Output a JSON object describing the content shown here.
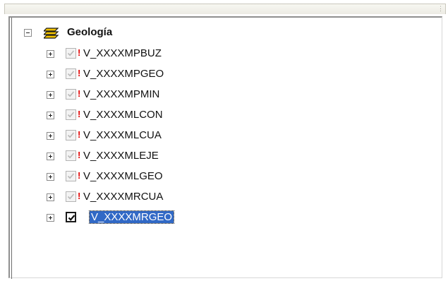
{
  "toc": {
    "group": {
      "label": "Geología",
      "expanded": true,
      "icon": "layers-icon"
    },
    "layers": [
      {
        "label": "V_XXXXMPBUZ",
        "checked": true,
        "disabled": true,
        "warning": true
      },
      {
        "label": "V_XXXXMPGEO",
        "checked": true,
        "disabled": true,
        "warning": true
      },
      {
        "label": "V_XXXXMPMIN",
        "checked": true,
        "disabled": true,
        "warning": true
      },
      {
        "label": "V_XXXXMLCON",
        "checked": true,
        "disabled": true,
        "warning": true
      },
      {
        "label": "V_XXXXMLCUA",
        "checked": true,
        "disabled": true,
        "warning": true
      },
      {
        "label": "V_XXXXMLEJE",
        "checked": true,
        "disabled": true,
        "warning": true
      },
      {
        "label": "V_XXXXMLGEO",
        "checked": true,
        "disabled": true,
        "warning": true
      },
      {
        "label": "V_XXXXMRCUA",
        "checked": true,
        "disabled": true,
        "warning": true
      },
      {
        "label": "V_XXXXMRGEO",
        "checked": true,
        "disabled": false,
        "warning": false,
        "selected": true
      }
    ]
  },
  "colors": {
    "selection": "#3169c6",
    "warning": "#e00000",
    "layers_icon": "#f2c200"
  }
}
